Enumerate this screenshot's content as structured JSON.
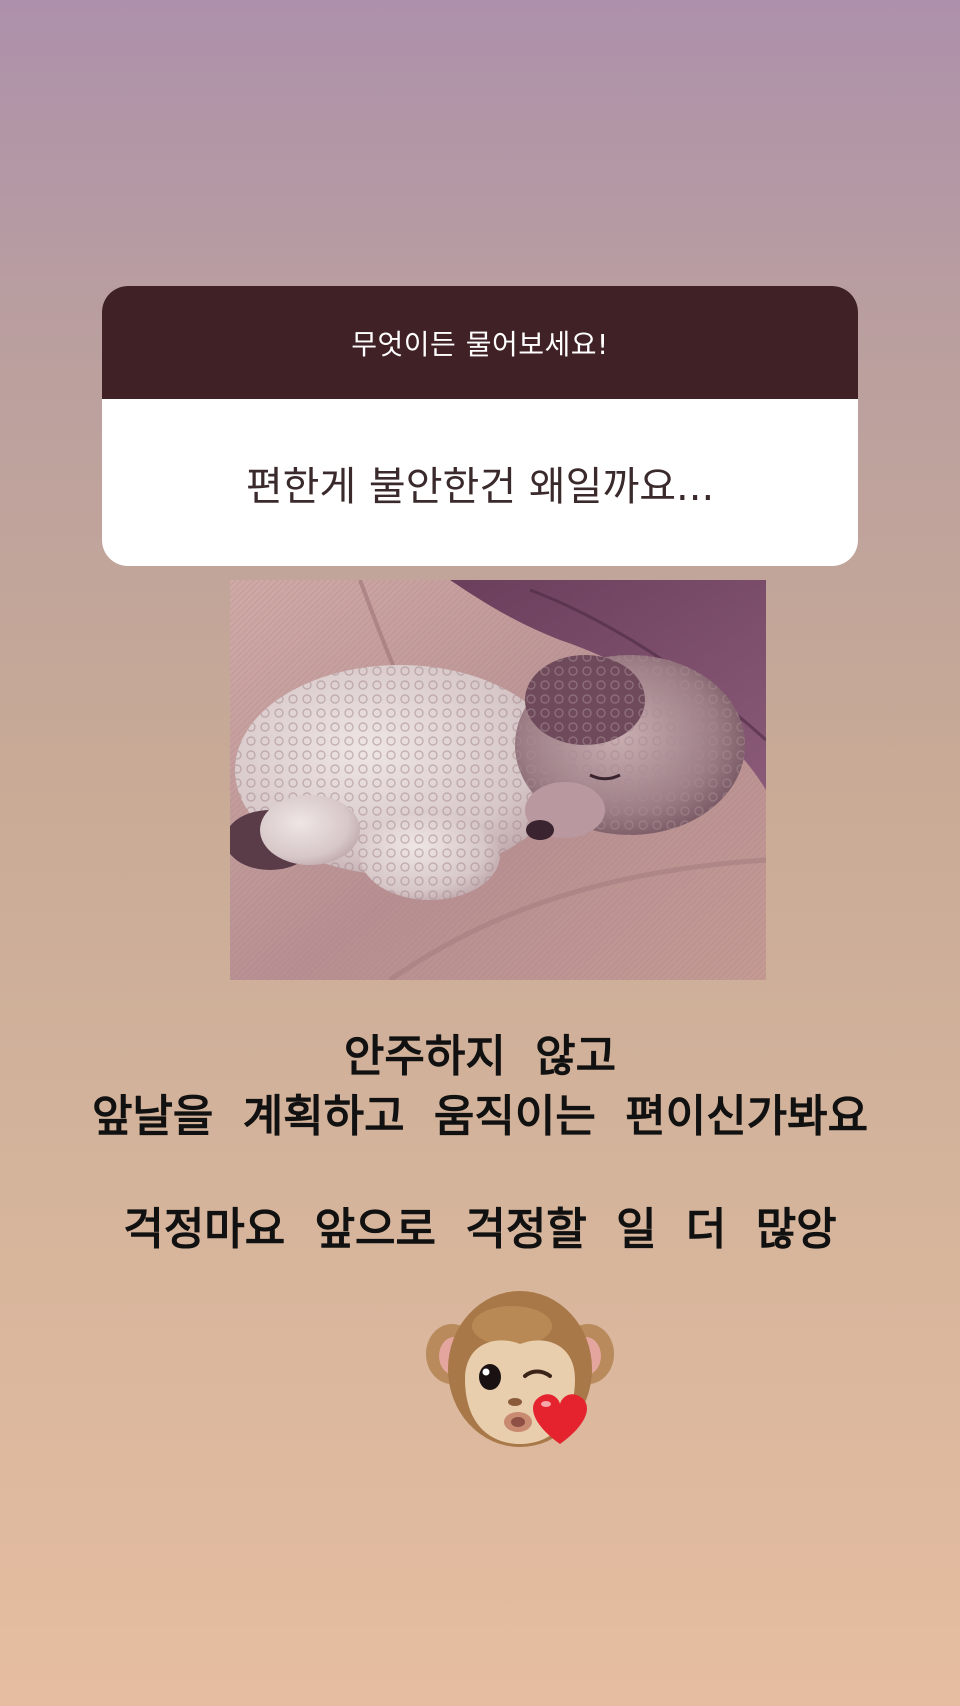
{
  "question_sticker": {
    "prompt": "무엇이든 물어보세요!",
    "answer": "편한게 불안한건 왜일까요..."
  },
  "photo": {
    "subject": "curly-haired poodle sleeping on a sofa cushion"
  },
  "caption": {
    "line1": "안주하지 않고",
    "line2": "앞날을 계획하고 움직이는 편이신가봐요",
    "line3": "걱정마요 앞으로 걱정할 일 더 많앙"
  },
  "sticker": {
    "icon": "monkey-kiss-heart-animoji"
  },
  "colors": {
    "header_bg": "#402226",
    "background_top": "#ad90ab",
    "background_bottom": "#e6bda0",
    "heart": "#e5232f"
  }
}
